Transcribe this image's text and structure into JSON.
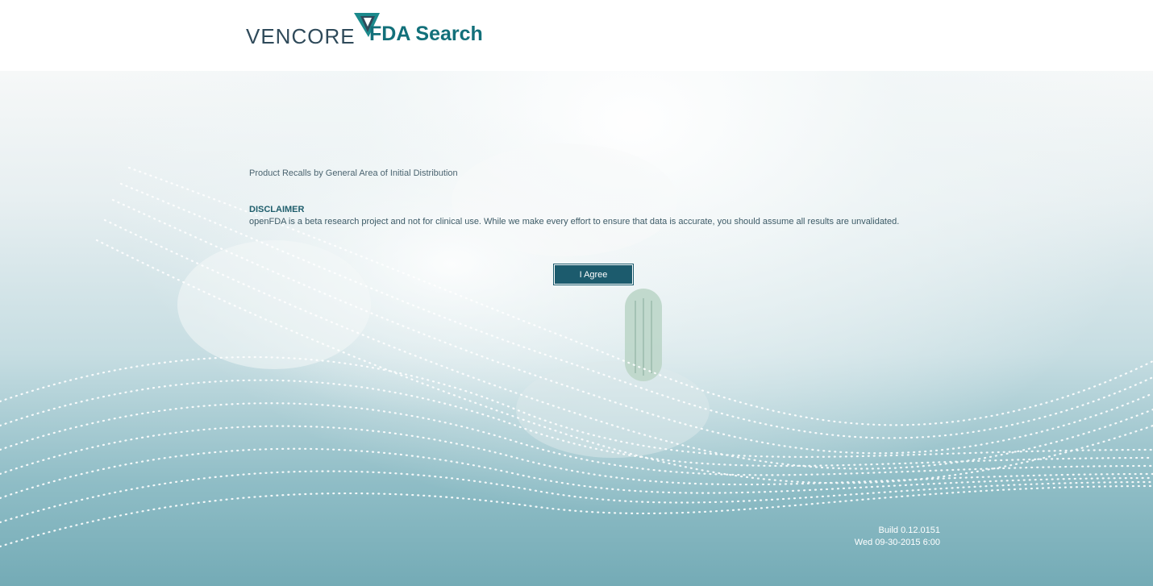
{
  "header": {
    "brand_name": "VENCORE",
    "app_title": "FDA Search"
  },
  "main": {
    "subtitle": "Product Recalls by General Area of Initial Distribution",
    "disclaimer_heading": "DISCLAIMER",
    "disclaimer_text": "openFDA is a beta research project and not for clinical use. While we make every effort to ensure that data is accurate, you should assume all results are unvalidated.",
    "agree_button_label": "I Agree"
  },
  "footer": {
    "build": "Build 0.12.0151",
    "build_date": "Wed 09-30-2015 6:00"
  },
  "colors": {
    "brand_teal": "#12707a",
    "button_bg": "#1c5b6d",
    "logo_text": "#2f4a5a"
  }
}
